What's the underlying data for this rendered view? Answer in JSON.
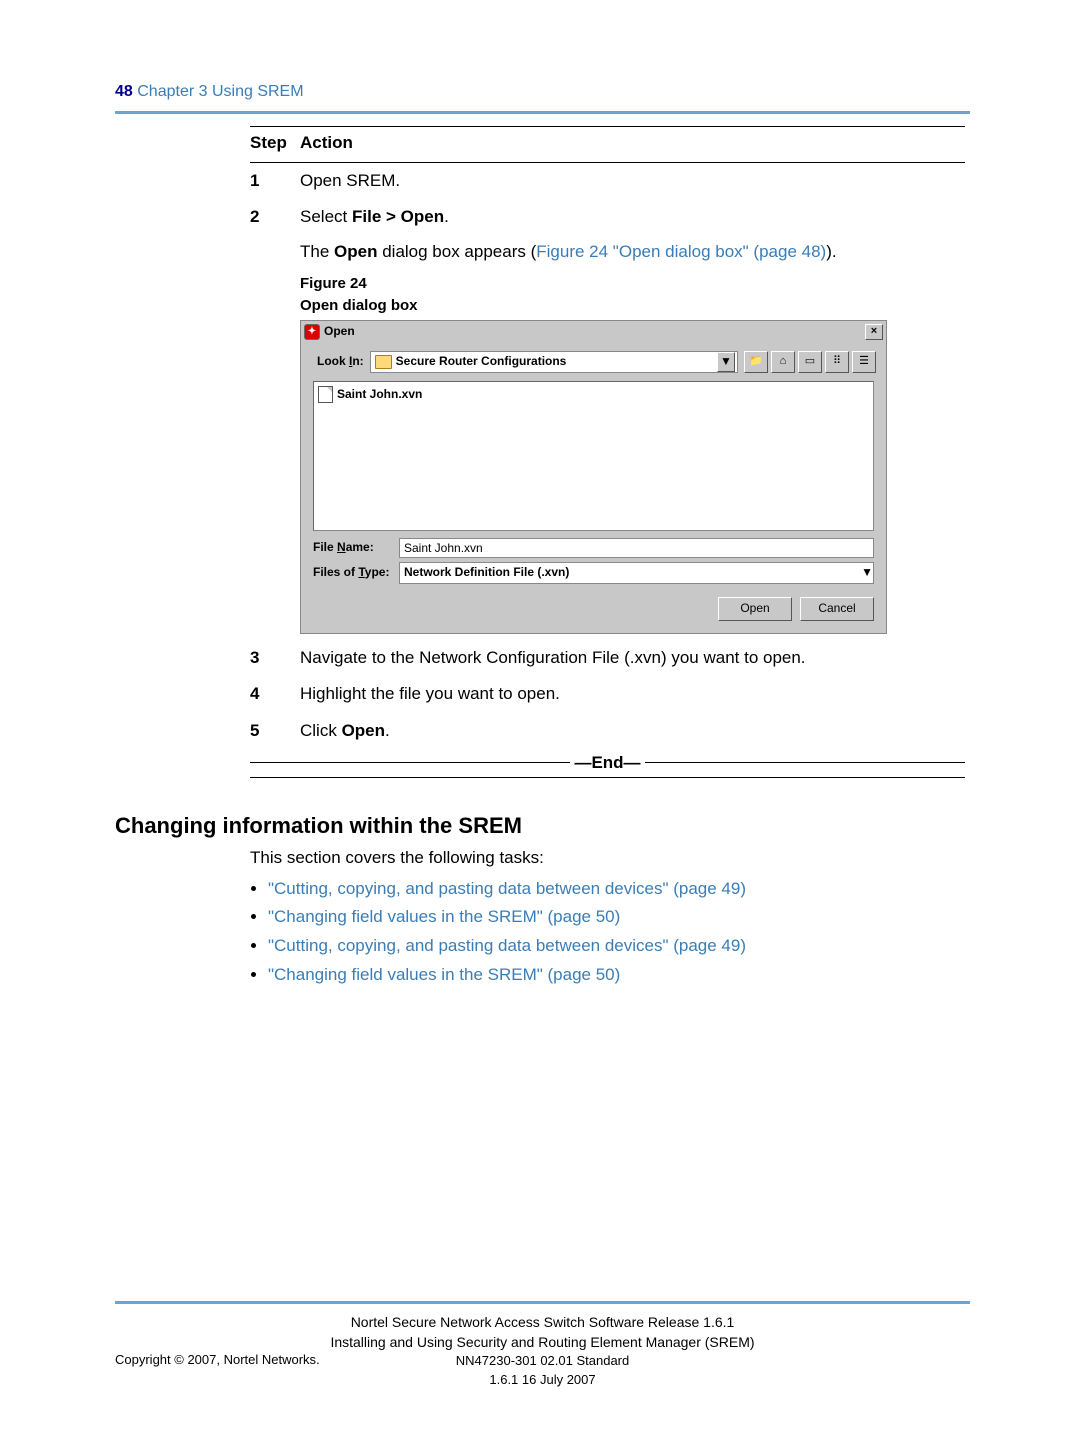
{
  "header": {
    "page_number": "48",
    "chapter": "Chapter 3  Using SREM"
  },
  "step_action_header": {
    "step": "Step",
    "action": "Action"
  },
  "steps": {
    "s1": {
      "num": "1",
      "text": "Open SREM."
    },
    "s2": {
      "num": "2",
      "text_prefix": "Select ",
      "bold": "File > Open",
      "text_suffix": ".",
      "desc_prefix": "The ",
      "desc_bold": "Open",
      "desc_mid": " dialog box appears (",
      "desc_link": "Figure 24 \"Open dialog box\" (page 48)",
      "desc_suffix": ")."
    },
    "fig": {
      "label": "Figure 24",
      "caption": "Open dialog box"
    },
    "s3": {
      "num": "3",
      "text": "Navigate to the Network Configuration File (.xvn) you want to open."
    },
    "s4": {
      "num": "4",
      "text": "Highlight the file you want to open."
    },
    "s5": {
      "num": "5",
      "text_prefix": "Click ",
      "bold": "Open",
      "text_suffix": "."
    }
  },
  "dialog": {
    "title": "Open",
    "look_in_label": "Look In:",
    "look_in_value": "Secure Router Configurations",
    "file_item": "Saint John.xvn",
    "file_name_label": "File Name:",
    "file_name_value": "Saint John.xvn",
    "files_of_type_label": "Files of Type:",
    "files_of_type_value": "Network Definition File (.xvn)",
    "open_btn": "Open",
    "cancel_btn": "Cancel"
  },
  "end_label": "—End—",
  "section2": {
    "title": "Changing information within the SREM",
    "intro": "This section covers the following tasks:",
    "links": [
      "\"Cutting, copying, and pasting data between devices\" (page 49)",
      "\"Changing field values in the SREM\" (page 50)",
      "\"Cutting, copying, and pasting data between devices\" (page 49)",
      "\"Changing field values in the SREM\" (page 50)"
    ]
  },
  "footer": {
    "line1": "Nortel Secure Network Access Switch Software Release 1.6.1",
    "line2": "Installing and Using Security and Routing Element Manager (SREM)",
    "line3": "NN47230-301   02.01   Standard",
    "line4": "1.6.1   16 July 2007",
    "copyright": "Copyright © 2007, Nortel Networks",
    "dot": "."
  }
}
